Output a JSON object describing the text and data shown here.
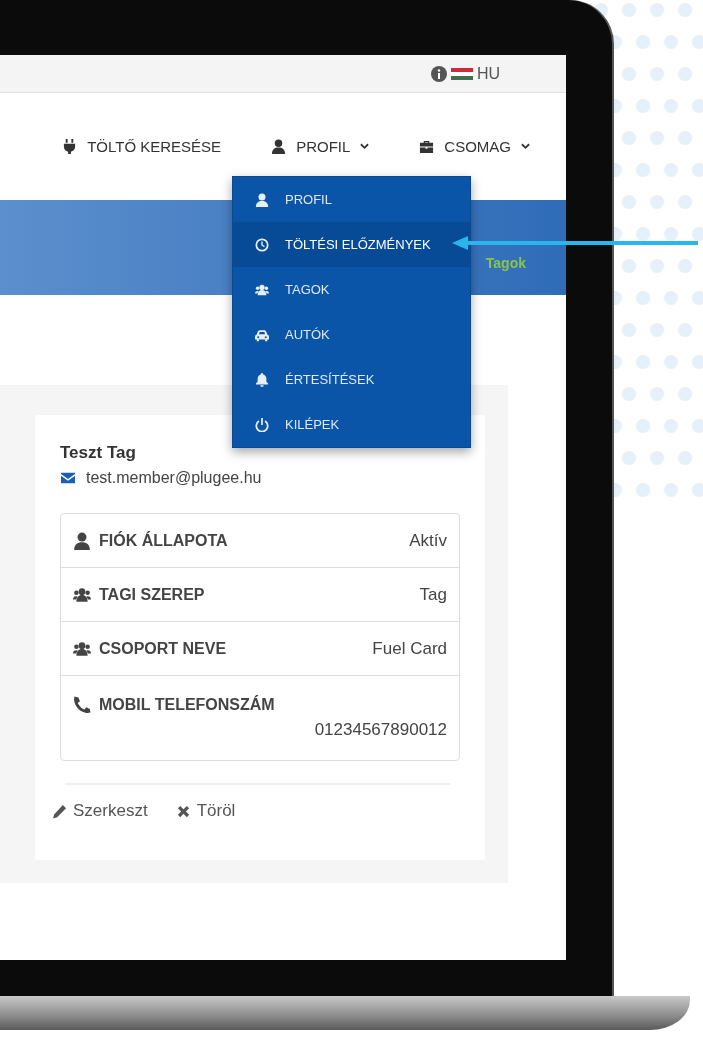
{
  "top_bar": {
    "language": "HU"
  },
  "nav": [
    {
      "label": "TÖLTŐ KERESÉSE"
    },
    {
      "label": "PROFIL"
    },
    {
      "label": "CSOMAG"
    }
  ],
  "dropdown": {
    "items": [
      {
        "label": "PROFIL",
        "selected": false
      },
      {
        "label": "TÖLTÉSI ELŐZMÉNYEK",
        "selected": true
      },
      {
        "label": "TAGOK",
        "selected": false
      },
      {
        "label": "AUTÓK",
        "selected": false
      },
      {
        "label": "ÉRTESÍTÉSEK",
        "selected": false
      },
      {
        "label": "KILÉPEK",
        "selected": false
      }
    ]
  },
  "banner": {
    "breadcrumb": "Tagok"
  },
  "member": {
    "name": "Teszt Tag",
    "email": "test.member@plugee.hu",
    "details": [
      {
        "kind": "inline",
        "label": "FIÓK ÁLLAPOTA",
        "value": "Aktív"
      },
      {
        "kind": "inline",
        "label": "TAGI SZEREP",
        "value": "Tag"
      },
      {
        "kind": "inline",
        "label": "CSOPORT NEVE",
        "value": "Fuel Card"
      },
      {
        "kind": "stacked",
        "label": "MOBIL TELEFONSZÁM",
        "value": "01234567890012"
      }
    ],
    "actions": [
      {
        "label": "Szerkeszt"
      },
      {
        "label": "Töröl"
      }
    ]
  }
}
